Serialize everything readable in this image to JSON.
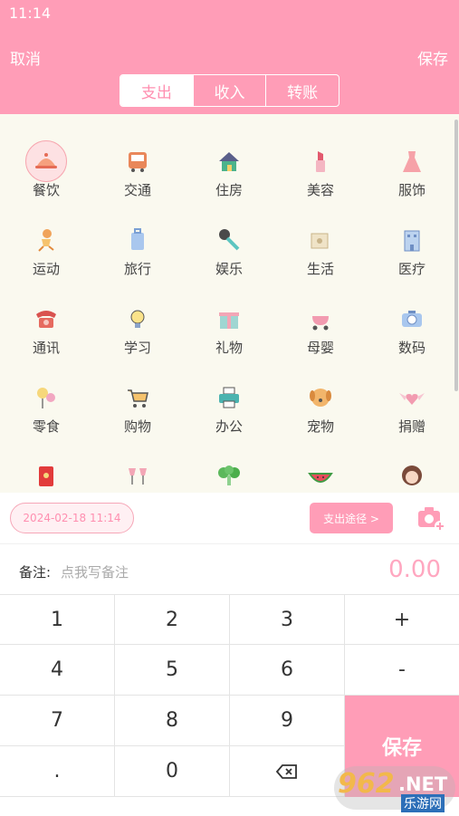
{
  "status_bar": {
    "time": "11:14"
  },
  "header": {
    "cancel_label": "取消",
    "save_label": "保存",
    "tabs": [
      {
        "label": "支出",
        "active": true
      },
      {
        "label": "收入",
        "active": false
      },
      {
        "label": "转账",
        "active": false
      }
    ]
  },
  "categories": [
    {
      "label": "餐饮",
      "icon": "dish-cover-icon",
      "selected": true
    },
    {
      "label": "交通",
      "icon": "bus-icon"
    },
    {
      "label": "住房",
      "icon": "house-icon"
    },
    {
      "label": "美容",
      "icon": "lipstick-icon"
    },
    {
      "label": "服饰",
      "icon": "dress-icon"
    },
    {
      "label": "运动",
      "icon": "running-kid-icon"
    },
    {
      "label": "旅行",
      "icon": "suitcase-icon"
    },
    {
      "label": "娱乐",
      "icon": "microphone-icon"
    },
    {
      "label": "生活",
      "icon": "toilet-paper-icon"
    },
    {
      "label": "医疗",
      "icon": "hospital-icon"
    },
    {
      "label": "通讯",
      "icon": "telephone-icon"
    },
    {
      "label": "学习",
      "icon": "lightbulb-icon"
    },
    {
      "label": "礼物",
      "icon": "gift-icon"
    },
    {
      "label": "母婴",
      "icon": "stroller-icon"
    },
    {
      "label": "数码",
      "icon": "camera-icon"
    },
    {
      "label": "零食",
      "icon": "candy-icon"
    },
    {
      "label": "购物",
      "icon": "shopping-cart-icon"
    },
    {
      "label": "办公",
      "icon": "printer-icon"
    },
    {
      "label": "宠物",
      "icon": "dog-icon"
    },
    {
      "label": "捐赠",
      "icon": "winged-heart-icon"
    },
    {
      "label": "随礼",
      "icon": "red-envelope-icon"
    },
    {
      "label": "社交",
      "icon": "wine-glasses-icon"
    },
    {
      "label": "蔬菜",
      "icon": "broccoli-icon"
    },
    {
      "label": "水果",
      "icon": "watermelon-icon"
    },
    {
      "label": "恋爱",
      "icon": "girl-icon"
    }
  ],
  "record": {
    "datetime": "2024-02-18 11:14",
    "route_label": "支出途径 >",
    "note_label": "备注:",
    "note_placeholder": "点我写备注",
    "amount": "0.00"
  },
  "keypad": {
    "keys": [
      "1",
      "2",
      "3",
      "+",
      "4",
      "5",
      "6",
      "-",
      "7",
      "8",
      "9",
      ".",
      "0"
    ],
    "save_label": "保存"
  },
  "watermark": {
    "number": "962",
    "suffix": ".NET",
    "site": "乐游网"
  },
  "colors": {
    "primary": "#ff9db7",
    "grid_bg": "#faf9ef",
    "amount": "#ffa7c0"
  }
}
